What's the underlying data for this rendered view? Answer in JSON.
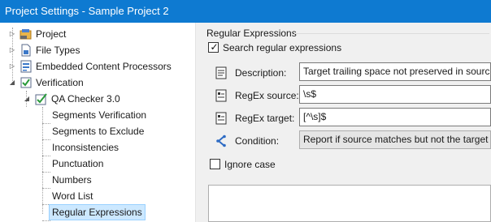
{
  "window": {
    "title": "Project Settings - Sample Project 2"
  },
  "tree": {
    "items": [
      {
        "label": "Project",
        "icon": "project-icon"
      },
      {
        "label": "File Types",
        "icon": "file-types-icon"
      },
      {
        "label": "Embedded Content Processors",
        "icon": "embedded-content-icon"
      },
      {
        "label": "Verification",
        "icon": "verification-icon"
      },
      {
        "label": "QA Checker 3.0",
        "icon": "qa-checker-icon"
      },
      {
        "label": "Segments Verification"
      },
      {
        "label": "Segments to Exclude"
      },
      {
        "label": "Inconsistencies"
      },
      {
        "label": "Punctuation"
      },
      {
        "label": "Numbers"
      },
      {
        "label": "Word List"
      },
      {
        "label": "Regular Expressions",
        "selected": true
      }
    ]
  },
  "panel": {
    "group_title": "Regular Expressions",
    "search_checkbox": {
      "label": "Search regular expressions",
      "checked": true
    },
    "description": {
      "label": "Description:",
      "value": "Target trailing space not preserved in source"
    },
    "regex_source": {
      "label": "RegEx source:",
      "value": "\\s$"
    },
    "regex_target": {
      "label": "RegEx target:",
      "value": "[^\\s]$"
    },
    "condition": {
      "label": "Condition:",
      "value": "Report if source matches but not the target"
    },
    "ignore_case": {
      "label": "Ignore case",
      "checked": false
    }
  },
  "colors": {
    "titlebar": "#0e7ad1",
    "panel_bg": "#f0f0f0",
    "selection_bg": "#cce8ff"
  }
}
